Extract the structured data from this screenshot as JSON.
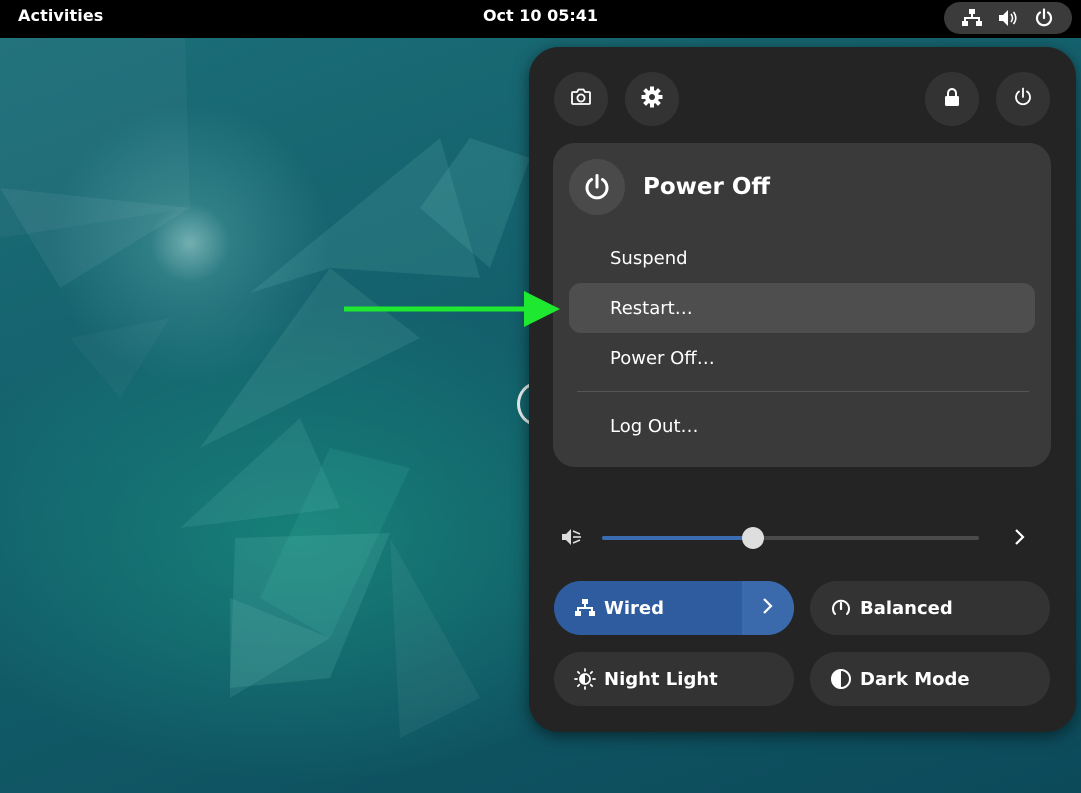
{
  "topbar": {
    "activities_label": "Activities",
    "clock": "Oct 10  05:41",
    "status_icons": [
      "network-wired-icon",
      "volume-icon",
      "power-icon"
    ]
  },
  "quick_settings": {
    "top_buttons": [
      {
        "name": "screenshot",
        "icon": "camera-icon"
      },
      {
        "name": "settings",
        "icon": "gear-icon"
      },
      {
        "name": "lock",
        "icon": "lock-icon"
      },
      {
        "name": "power",
        "icon": "power-icon"
      }
    ],
    "power_menu": {
      "title": "Power Off",
      "items": [
        {
          "label": "Suspend",
          "highlighted": false
        },
        {
          "label": "Restart…",
          "highlighted": true
        },
        {
          "label": "Power Off…",
          "highlighted": false
        },
        {
          "label": "Log Out…",
          "highlighted": false
        }
      ]
    },
    "volume": {
      "icon": "volume-muted-icon",
      "level_fraction": 0.4
    },
    "toggles": [
      {
        "label": "Wired",
        "icon": "network-wired-icon",
        "active": true,
        "has_arrow": true
      },
      {
        "label": "Balanced",
        "icon": "power-profile-icon",
        "active": false
      },
      {
        "label": "Night Light",
        "icon": "night-light-icon",
        "active": false
      },
      {
        "label": "Dark Mode",
        "icon": "dark-mode-icon",
        "active": false
      }
    ]
  },
  "colors": {
    "panel_bg": "#242424",
    "submenu_bg": "#3a3a3a",
    "accent": "#2f5c9e",
    "annotation_arrow": "#1ee830"
  }
}
